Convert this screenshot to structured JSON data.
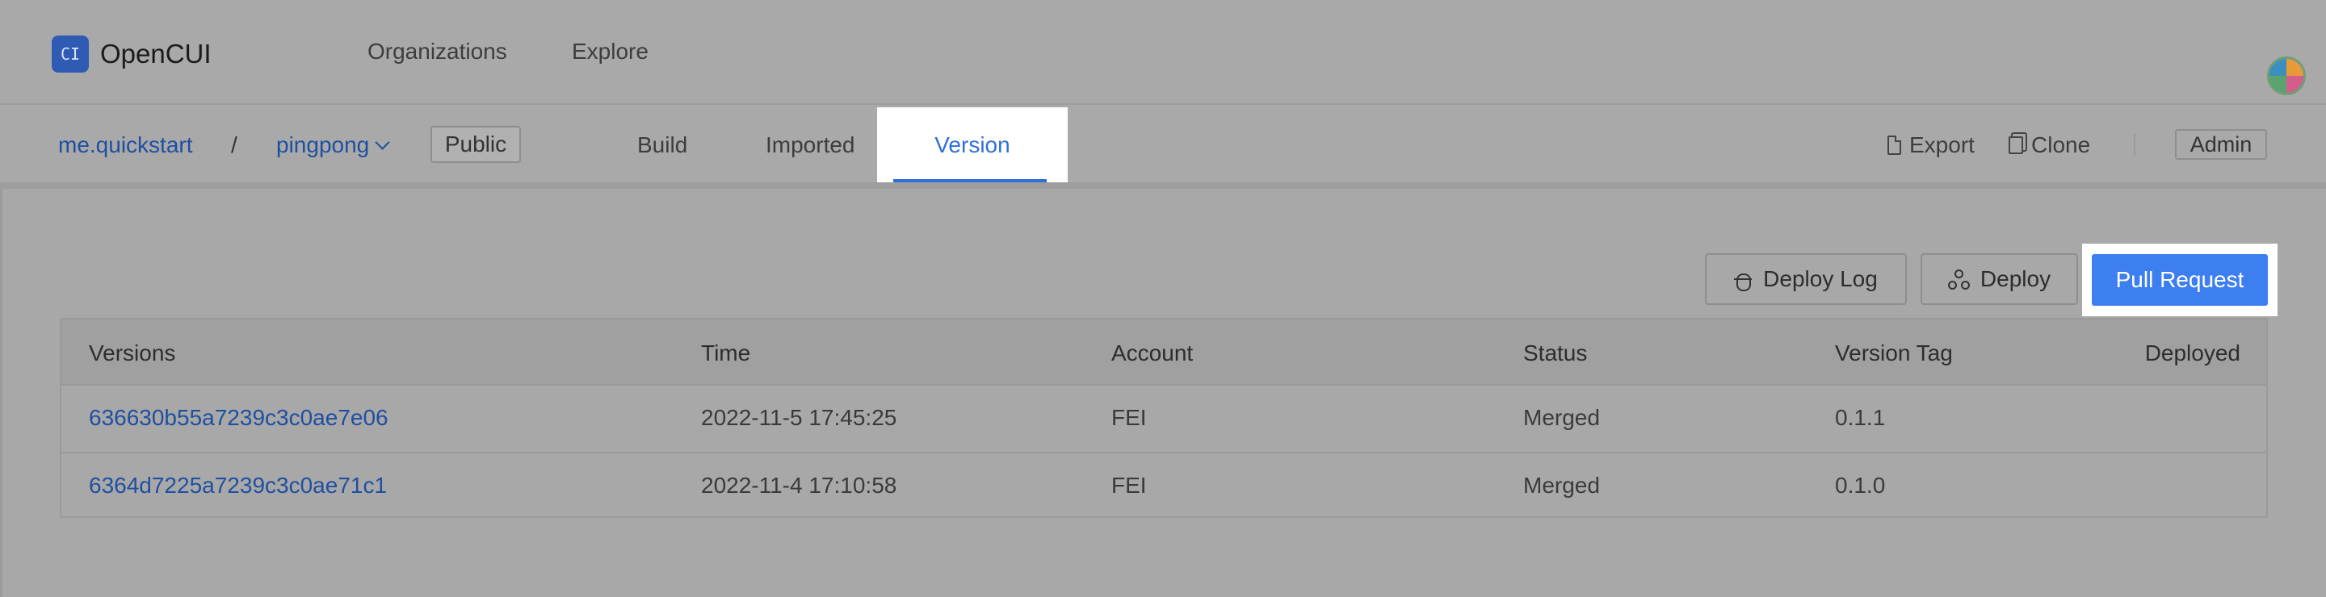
{
  "app": {
    "logo_text": "OpenCUI",
    "logo_mark": "CI"
  },
  "topnav": {
    "organizations": "Organizations",
    "explore": "Explore"
  },
  "breadcrumb": {
    "org": "me.quickstart",
    "separator": "/",
    "project": "pingpong",
    "visibility": "Public"
  },
  "tabs": [
    {
      "label": "Build",
      "active": false
    },
    {
      "label": "Imported",
      "active": false
    },
    {
      "label": "Version",
      "active": true
    }
  ],
  "actions": {
    "export": "Export",
    "clone": "Clone",
    "admin": "Admin"
  },
  "toolbar": {
    "deploy_log": "Deploy Log",
    "deploy": "Deploy",
    "pull_request": "Pull Request"
  },
  "table": {
    "columns": [
      "Versions",
      "Time",
      "Account",
      "Status",
      "Version Tag",
      "Deployed"
    ],
    "rows": [
      {
        "version": "636630b55a7239c3c0ae7e06",
        "time": "2022-11-5 17:45:25",
        "account": "FEI",
        "status": "Merged",
        "tag": "0.1.1",
        "deployed": ""
      },
      {
        "version": "6364d7225a7239c3c0ae71c1",
        "time": "2022-11-4 17:10:58",
        "account": "FEI",
        "status": "Merged",
        "tag": "0.1.0",
        "deployed": ""
      }
    ]
  },
  "colors": {
    "accent": "#3d7ef0",
    "link": "#1f4fa0",
    "overlay": "#a9a9a9"
  },
  "icons": [
    "opencui-logo-icon",
    "chevron-down-icon",
    "export-icon",
    "clone-icon",
    "bug-icon",
    "deploy-icon",
    "avatar"
  ]
}
